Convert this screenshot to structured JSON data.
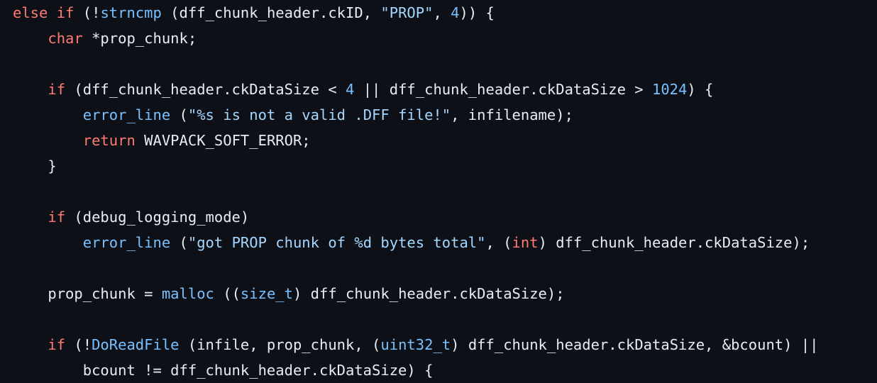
{
  "theme": {
    "background": "#0d1117",
    "text": "#e6edf3",
    "keyword": "#ff7b72",
    "function": "#79c0ff",
    "string": "#a5d6ff",
    "number": "#79c0ff"
  },
  "lines": [
    [
      {
        "t": "keyword",
        "v": "else"
      },
      {
        "t": "plain",
        "v": " "
      },
      {
        "t": "keyword",
        "v": "if"
      },
      {
        "t": "plain",
        "v": " (!"
      },
      {
        "t": "func",
        "v": "strncmp"
      },
      {
        "t": "plain",
        "v": " (dff_chunk_header.ckID, "
      },
      {
        "t": "string",
        "v": "\"PROP\""
      },
      {
        "t": "plain",
        "v": ", "
      },
      {
        "t": "number",
        "v": "4"
      },
      {
        "t": "plain",
        "v": ")) {"
      }
    ],
    [
      {
        "t": "plain",
        "v": "    "
      },
      {
        "t": "keyword",
        "v": "char"
      },
      {
        "t": "plain",
        "v": " *prop_chunk;"
      }
    ],
    [],
    [
      {
        "t": "plain",
        "v": "    "
      },
      {
        "t": "keyword",
        "v": "if"
      },
      {
        "t": "plain",
        "v": " (dff_chunk_header.ckDataSize < "
      },
      {
        "t": "number",
        "v": "4"
      },
      {
        "t": "plain",
        "v": " || dff_chunk_header.ckDataSize > "
      },
      {
        "t": "number",
        "v": "1024"
      },
      {
        "t": "plain",
        "v": ") {"
      }
    ],
    [
      {
        "t": "plain",
        "v": "        "
      },
      {
        "t": "func",
        "v": "error_line"
      },
      {
        "t": "plain",
        "v": " ("
      },
      {
        "t": "string",
        "v": "\"%s is not a valid .DFF file!\""
      },
      {
        "t": "plain",
        "v": ", infilename);"
      }
    ],
    [
      {
        "t": "plain",
        "v": "        "
      },
      {
        "t": "keyword",
        "v": "return"
      },
      {
        "t": "plain",
        "v": " WAVPACK_SOFT_ERROR;"
      }
    ],
    [
      {
        "t": "plain",
        "v": "    }"
      }
    ],
    [],
    [
      {
        "t": "plain",
        "v": "    "
      },
      {
        "t": "keyword",
        "v": "if"
      },
      {
        "t": "plain",
        "v": " (debug_logging_mode)"
      }
    ],
    [
      {
        "t": "plain",
        "v": "        "
      },
      {
        "t": "func",
        "v": "error_line"
      },
      {
        "t": "plain",
        "v": " ("
      },
      {
        "t": "string",
        "v": "\"got PROP chunk of %d bytes total\""
      },
      {
        "t": "plain",
        "v": ", ("
      },
      {
        "t": "keyword",
        "v": "int"
      },
      {
        "t": "plain",
        "v": ") dff_chunk_header.ckDataSize);"
      }
    ],
    [],
    [
      {
        "t": "plain",
        "v": "    prop_chunk = "
      },
      {
        "t": "func",
        "v": "malloc"
      },
      {
        "t": "plain",
        "v": " (("
      },
      {
        "t": "func",
        "v": "size_t"
      },
      {
        "t": "plain",
        "v": ") dff_chunk_header.ckDataSize);"
      }
    ],
    [],
    [
      {
        "t": "plain",
        "v": "    "
      },
      {
        "t": "keyword",
        "v": "if"
      },
      {
        "t": "plain",
        "v": " (!"
      },
      {
        "t": "func",
        "v": "DoReadFile"
      },
      {
        "t": "plain",
        "v": " (infile, prop_chunk, ("
      },
      {
        "t": "func",
        "v": "uint32_t"
      },
      {
        "t": "plain",
        "v": ") dff_chunk_header.ckDataSize, &bcount) ||"
      }
    ],
    [
      {
        "t": "plain",
        "v": "        bcount != dff_chunk_header.ckDataSize) {"
      }
    ]
  ]
}
